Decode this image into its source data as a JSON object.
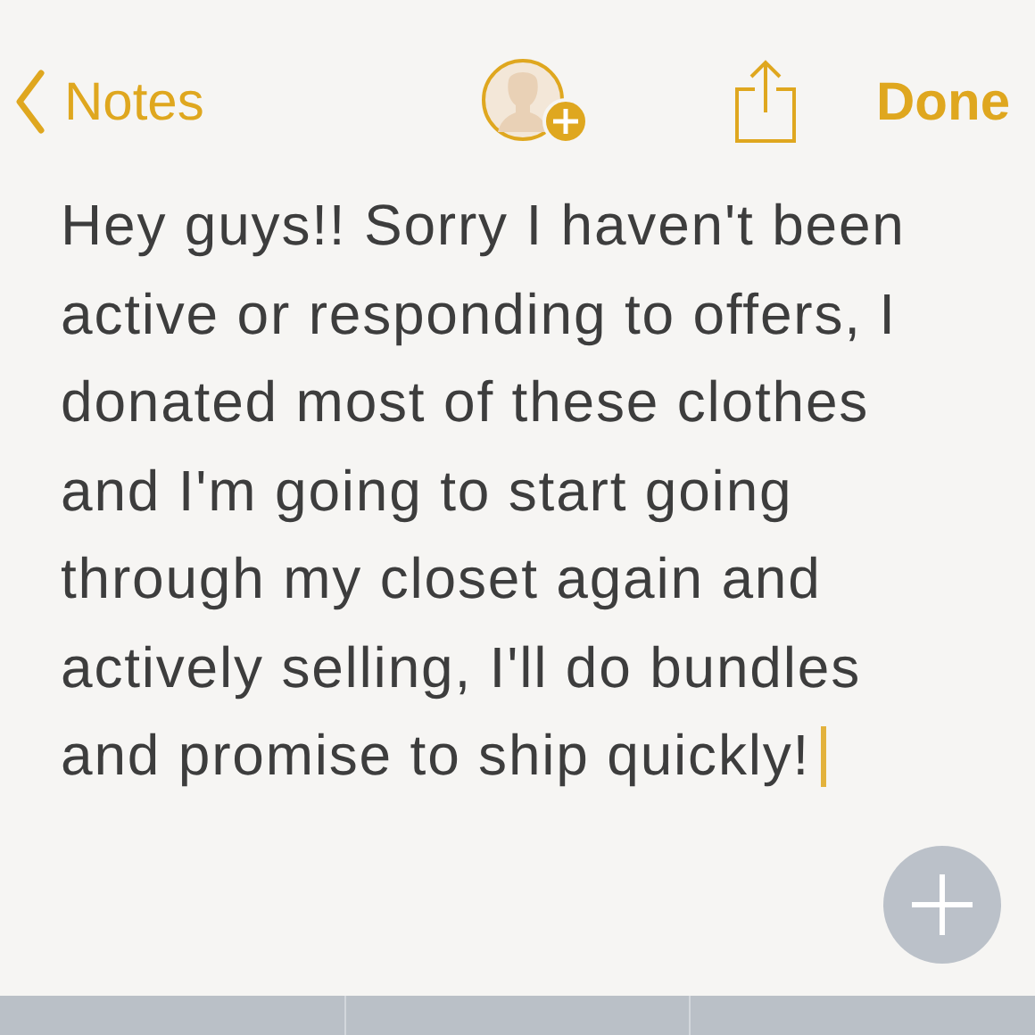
{
  "nav_bar": {
    "back_label": "Notes",
    "done_label": "Done"
  },
  "note": {
    "lines": [
      "Hey guys!! Sorry I haven't been",
      "active or responding to offers, I",
      "donated most of these clothes",
      "and I'm going to start going",
      "through my closet again and",
      "actively selling, I'll do bundles",
      "and promise to ship quickly!"
    ],
    "cursor_visible": true
  }
}
